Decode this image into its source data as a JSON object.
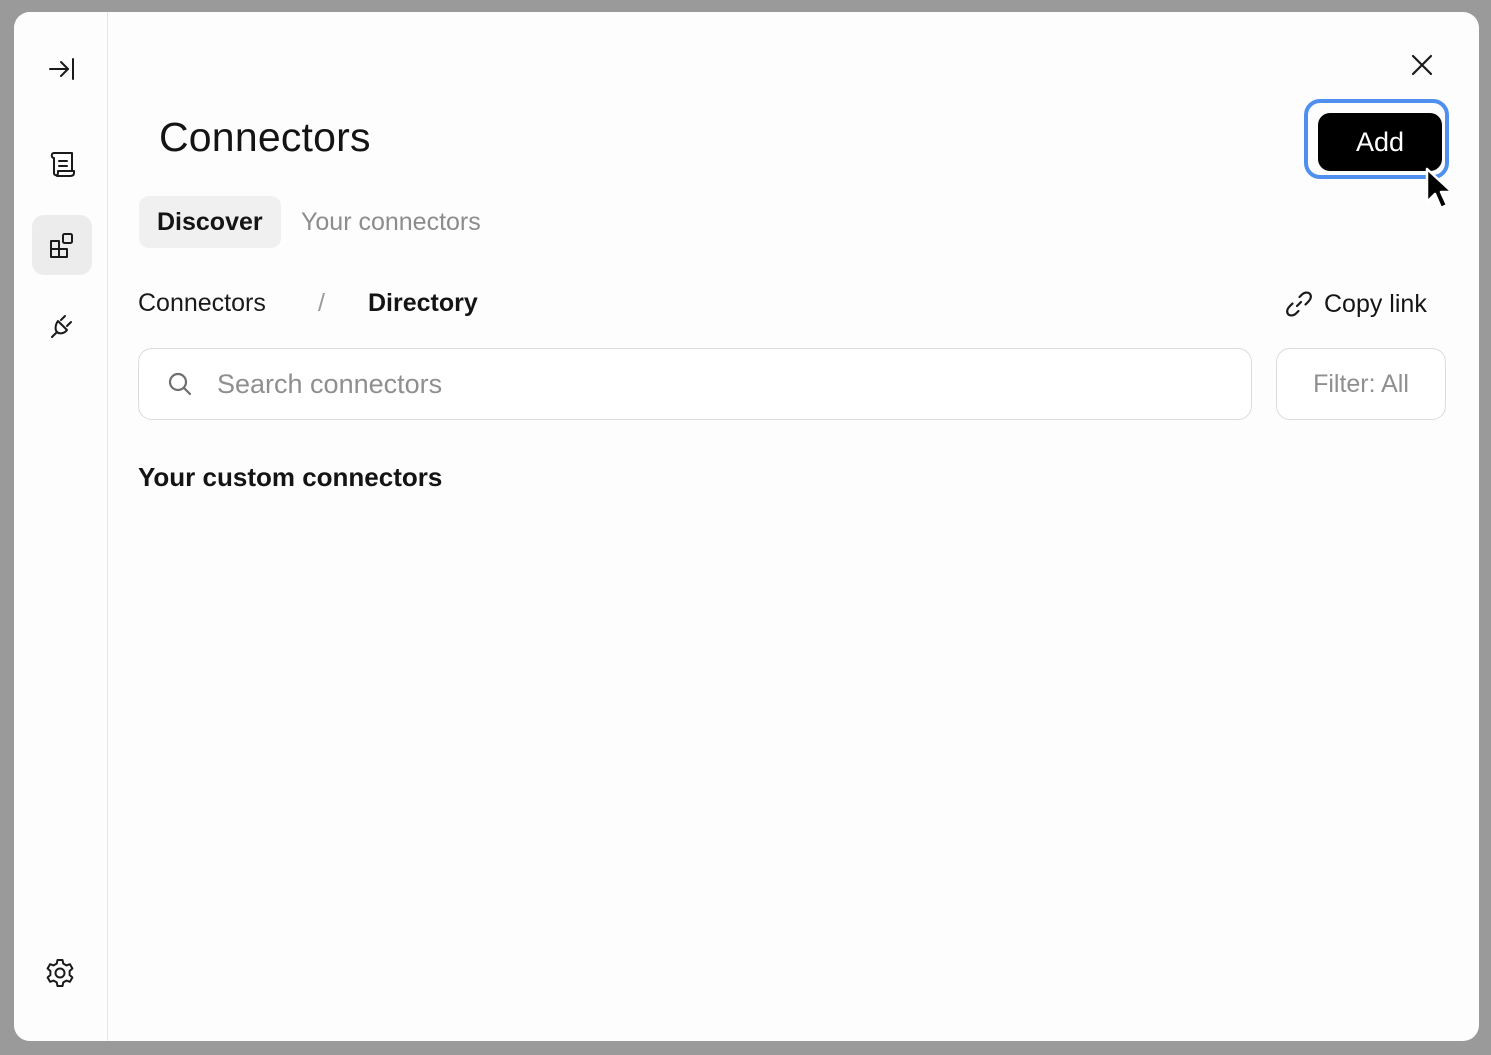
{
  "sidebar": {
    "items": [
      {
        "icon": "collapse-sidebar-icon"
      },
      {
        "icon": "scroll-icon"
      },
      {
        "icon": "connectors-icon",
        "active": true
      },
      {
        "icon": "plug-icon"
      }
    ],
    "footer_icon": "settings-gear-icon"
  },
  "header": {
    "title": "Connectors",
    "add_label": "Add",
    "close_icon": "close-icon"
  },
  "tabs": [
    {
      "label": "Discover",
      "active": true
    },
    {
      "label": "Your connectors",
      "active": false
    }
  ],
  "breadcrumb": {
    "items": [
      "Connectors",
      "Directory"
    ],
    "separator": "/"
  },
  "copy_link": {
    "label": "Copy link",
    "icon": "link-icon"
  },
  "search": {
    "placeholder": "Search connectors",
    "value": ""
  },
  "filter": {
    "label": "Filter: All"
  },
  "section": {
    "title": "Your custom connectors"
  },
  "colors": {
    "accent_ring": "#4f8ff0",
    "primary_button": "#000000",
    "active_tab_bg": "#f0f0f0",
    "muted_text": "#8c8c8c"
  }
}
